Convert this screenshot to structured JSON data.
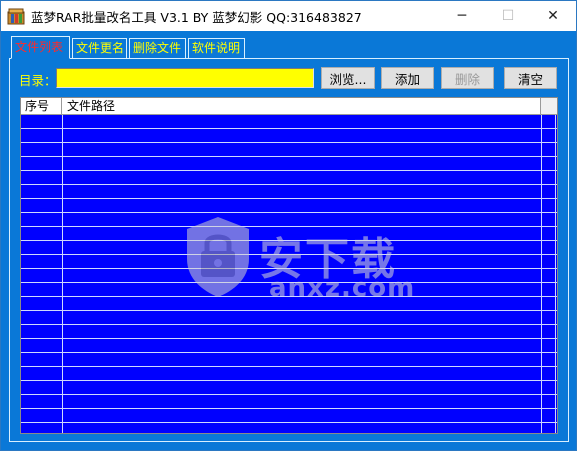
{
  "window": {
    "title": "蓝梦RAR批量改名工具 V3.1 BY 蓝梦幻影 QQ:316483827",
    "minimize_glyph": "─",
    "maximize_glyph": "☐",
    "close_glyph": "✕"
  },
  "tabs": [
    {
      "label": "文件列表",
      "active": true
    },
    {
      "label": "文件更名",
      "active": false
    },
    {
      "label": "删除文件",
      "active": false
    },
    {
      "label": "软件说明",
      "active": false
    }
  ],
  "directory": {
    "label": "目录：",
    "value": ""
  },
  "buttons": {
    "browse": "浏览...",
    "add": "添加",
    "delete": "删除",
    "clear": "清空"
  },
  "grid": {
    "columns": [
      "序号",
      "文件路径"
    ],
    "rows": []
  },
  "watermark": {
    "text": "安下载",
    "domain": "anxz.com"
  },
  "colors": {
    "client_bg": "#0a78d7",
    "grid_bg": "#0000ff",
    "input_bg": "#ffff00",
    "tab_text": "#ffff00",
    "active_tab_text": "#ff2a2a"
  },
  "icons": {
    "app": "archive-icon",
    "watermark": "shield-lock-icon"
  }
}
